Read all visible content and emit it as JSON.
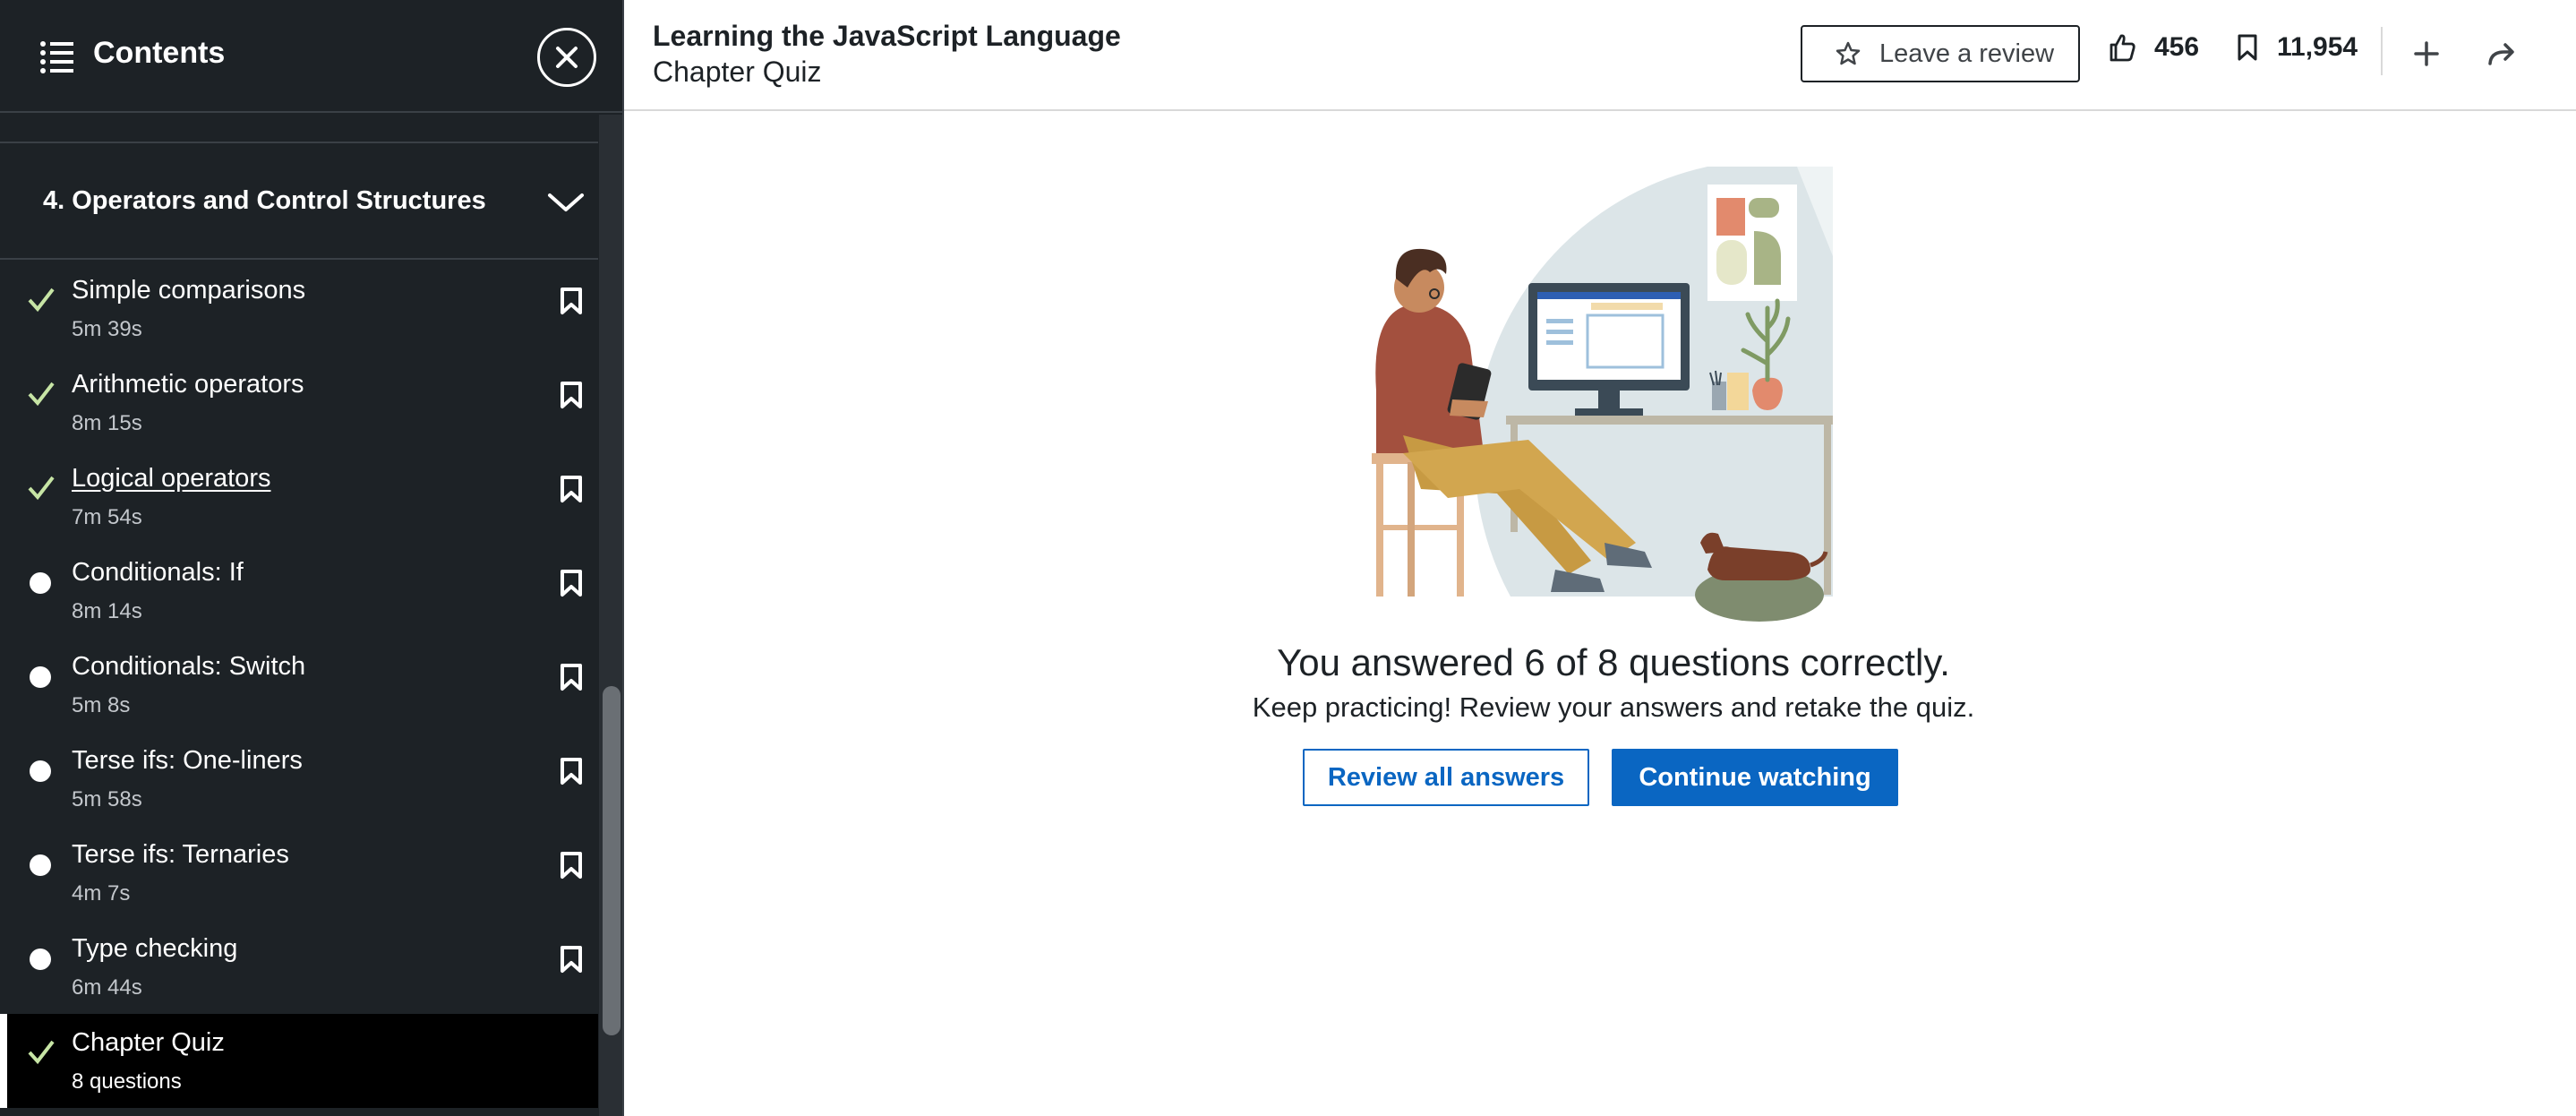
{
  "sidebar": {
    "title": "Contents",
    "section": {
      "label": "4. Operators and Control Structures"
    },
    "lessons": [
      {
        "title": "Simple comparisons",
        "duration": "5m 39s",
        "status": "completed"
      },
      {
        "title": "Arithmetic operators",
        "duration": "8m 15s",
        "status": "completed"
      },
      {
        "title": "Logical operators",
        "duration": "7m 54s",
        "status": "completed"
      },
      {
        "title": "Conditionals: If",
        "duration": "8m 14s",
        "status": "not-started"
      },
      {
        "title": "Conditionals: Switch",
        "duration": "5m 8s",
        "status": "not-started"
      },
      {
        "title": "Terse ifs: One-liners",
        "duration": "5m 58s",
        "status": "not-started"
      },
      {
        "title": "Terse ifs: Ternaries",
        "duration": "4m 7s",
        "status": "not-started"
      },
      {
        "title": "Type checking",
        "duration": "6m 44s",
        "status": "not-started"
      },
      {
        "title": "Chapter Quiz",
        "duration": "8 questions",
        "status": "completed"
      }
    ]
  },
  "header": {
    "course_title": "Learning the JavaScript Language",
    "lesson_title": "Chapter Quiz",
    "review_label": "Leave a review",
    "likes": "456",
    "saves": "11,954"
  },
  "main": {
    "result_title": "You answered 6 of 8 questions correctly.",
    "result_subtitle": "Keep practicing! Review your answers and retake the quiz.",
    "review_button": "Review all answers",
    "continue_button": "Continue watching"
  },
  "colors": {
    "sidebar_bg": "#1d2226",
    "accent": "#0a66c2",
    "check_green": "#c7e5a5"
  },
  "icons": [
    "list-icon",
    "close-icon",
    "chevron-down-icon",
    "checkmark-icon",
    "bookmark-icon",
    "star-icon",
    "thumbs-up-icon",
    "plus-icon",
    "share-icon"
  ]
}
